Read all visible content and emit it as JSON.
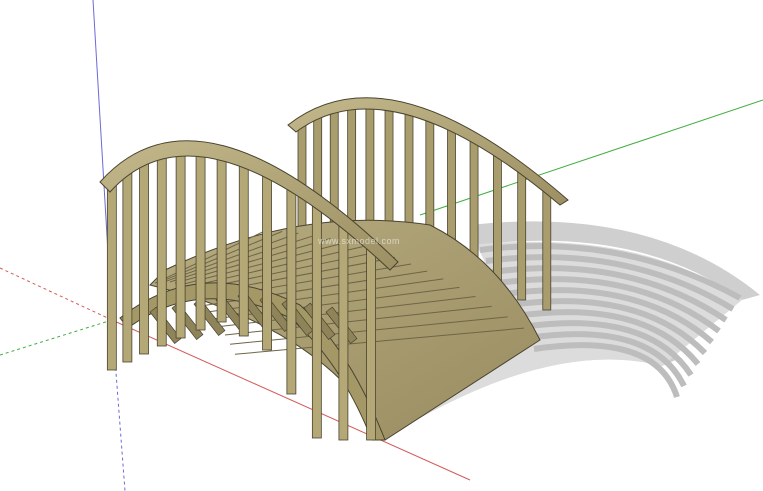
{
  "scene": {
    "subject": "arched-wooden-footbridge",
    "colors": {
      "background": "#ffffff",
      "wood_light": "#b9ad7f",
      "wood_mid": "#a69a6a",
      "wood_dark": "#7d7350",
      "wood_edge": "#4a4430",
      "shadow": "#c9c9c9",
      "axis_red": "#d45a5a",
      "axis_green": "#3fae3f",
      "axis_blue": "#6a6ad8"
    },
    "watermark": "www.sxmodel.com"
  }
}
